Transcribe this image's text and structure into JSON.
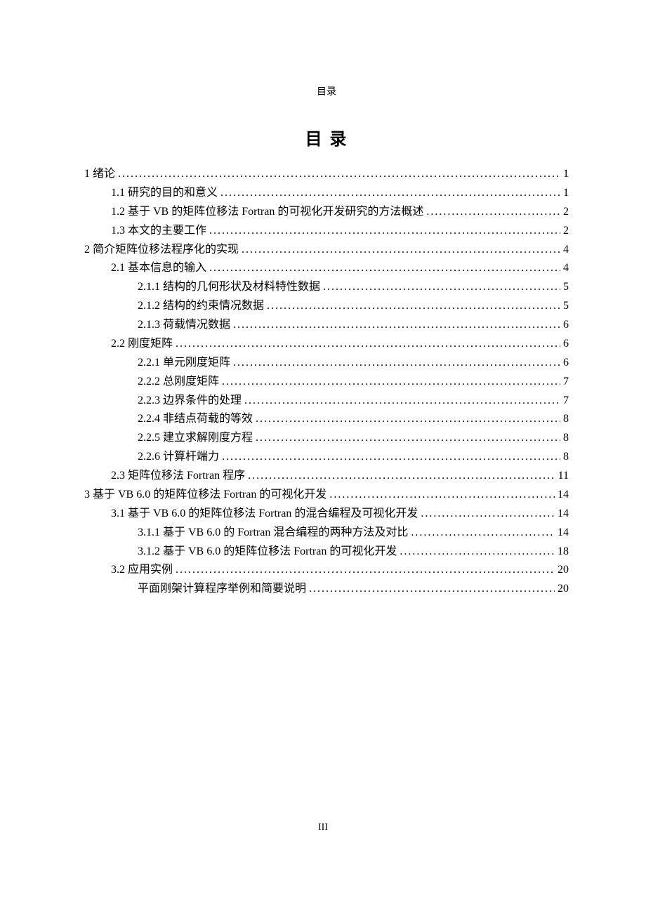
{
  "header_label": "目录",
  "title": "目 录",
  "page_number": "III",
  "toc": [
    {
      "level": 1,
      "text": "1 绪论 ",
      "page": "1"
    },
    {
      "level": 2,
      "text": "1.1 研究的目的和意义",
      "page": "1"
    },
    {
      "level": 2,
      "text": "1.2 基于 VB 的矩阵位移法 Fortran 的可视化开发研究的方法概述",
      "page": "2"
    },
    {
      "level": 2,
      "text": "1.3 本文的主要工作",
      "page": "2"
    },
    {
      "level": 1,
      "text": "2 简介矩阵位移法程序化的实现 ",
      "page": "4"
    },
    {
      "level": 2,
      "text": "2.1 基本信息的输入",
      "page": "4"
    },
    {
      "level": 3,
      "text": "2.1.1 结构的几何形状及材料特性数据 ",
      "page": "5"
    },
    {
      "level": 3,
      "text": "2.1.2 结构的约束情况数据 ",
      "page": "5"
    },
    {
      "level": 3,
      "text": "2.1.3 荷载情况数据 ",
      "page": "6"
    },
    {
      "level": 2,
      "text": "2.2 刚度矩阵",
      "page": "6"
    },
    {
      "level": 3,
      "text": "2.2.1 单元刚度矩阵 ",
      "page": "6"
    },
    {
      "level": 3,
      "text": "2.2.2 总刚度矩阵 ",
      "page": "7"
    },
    {
      "level": 3,
      "text": "2.2.3 边界条件的处理 ",
      "page": "7"
    },
    {
      "level": 3,
      "text": "2.2.4 非结点荷载的等效 ",
      "page": "8"
    },
    {
      "level": 3,
      "text": "2.2.5 建立求解刚度方程 ",
      "page": "8"
    },
    {
      "level": 3,
      "text": "2.2.6 计算杆端力 ",
      "page": "8"
    },
    {
      "level": 2,
      "text": "2.3 矩阵位移法 Fortran 程序",
      "page": "11"
    },
    {
      "level": 1,
      "text": "3 基于 VB 6.0 的矩阵位移法 Fortran 的可视化开发 ",
      "page": "14"
    },
    {
      "level": 2,
      "text": "3.1 基于 VB 6.0 的矩阵位移法 Fortran 的混合编程及可视化开发 ",
      "page": "14"
    },
    {
      "level": 3,
      "text": "3.1.1 基于 VB 6.0 的 Fortran 混合编程的两种方法及对比 ",
      "page": "14"
    },
    {
      "level": 3,
      "text": "3.1.2 基于 VB 6.0 的矩阵位移法 Fortran 的可视化开发 ",
      "page": "18"
    },
    {
      "level": 2,
      "text": "3.2 应用实例",
      "page": "20"
    },
    {
      "level": "3b",
      "text": "平面刚架计算程序举例和简要说明 ",
      "page": "20"
    }
  ]
}
